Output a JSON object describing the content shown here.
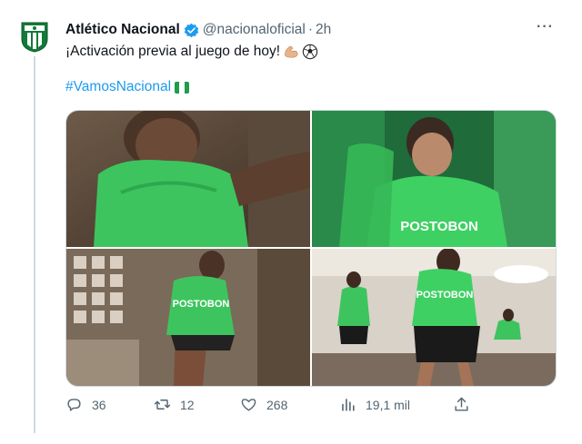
{
  "tweet": {
    "author_name": "Atlético Nacional",
    "handle": "@nacionaloficial",
    "separator": "·",
    "time": "2h",
    "more_label": "···",
    "text": "¡Activación previa al juego de hoy!",
    "emojis": [
      "flexed-biceps-emoji",
      "soccer-ball-emoji"
    ],
    "hashtag": "#VamosNacional",
    "flag": "nigeria-flag-emoji"
  },
  "media": {
    "photo_count": 4,
    "photos": [
      {
        "name": "player-portrait-green-shirt"
      },
      {
        "name": "player-warmup-postobon-shirt"
      },
      {
        "name": "player-walking-staircase"
      },
      {
        "name": "players-training-room"
      }
    ],
    "visible_text": [
      "POSTOBON",
      "POSTOBON",
      "POSTOBON"
    ]
  },
  "actions": {
    "replies": "36",
    "retweets": "12",
    "likes": "268",
    "views": "19,1 mil"
  },
  "colors": {
    "accent": "#1d9bf0",
    "muted": "#536471",
    "brand_green": "#1f9d4a",
    "kit_green": "#35c35a"
  }
}
